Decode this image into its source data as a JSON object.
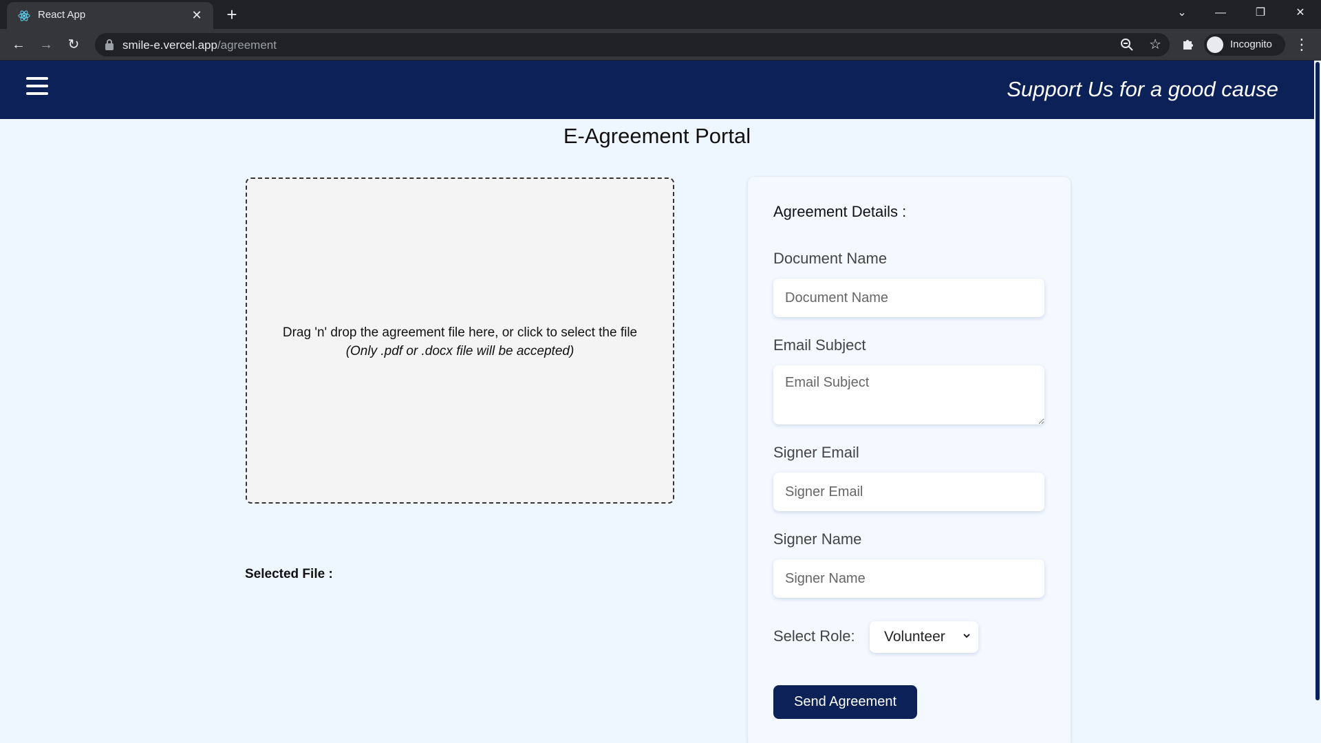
{
  "browser": {
    "tab_title": "React App",
    "tab_close": "✕",
    "new_tab": "+",
    "url_host": "smile-e.vercel.app",
    "url_path": "/agreement",
    "profile_label": "Incognito",
    "window_controls": {
      "tab_search": "⌄",
      "minimize": "—",
      "restore": "❐",
      "close": "✕"
    },
    "nav": {
      "back": "←",
      "forward": "→",
      "reload": "↻"
    },
    "menu": "⋮",
    "bookmark": "☆"
  },
  "header": {
    "tagline": "Support Us for a good cause"
  },
  "page": {
    "title": "E-Agreement Portal"
  },
  "dropzone": {
    "instruction": "Drag 'n' drop the agreement file here, or click to select the file",
    "hint": "(Only .pdf or .docx file will be accepted)"
  },
  "selected_file": {
    "label": "Selected File :"
  },
  "form": {
    "heading": "Agreement Details :",
    "document_name": {
      "label": "Document Name",
      "placeholder": "Document Name",
      "value": ""
    },
    "email_subject": {
      "label": "Email Subject",
      "placeholder": "Email Subject",
      "value": ""
    },
    "signer_email": {
      "label": "Signer Email",
      "placeholder": "Signer Email",
      "value": ""
    },
    "signer_name": {
      "label": "Signer Name",
      "placeholder": "Signer Name",
      "value": ""
    },
    "role": {
      "label": "Select Role:",
      "selected": "Volunteer"
    },
    "submit_label": "Send Agreement"
  },
  "colors": {
    "header_bg": "#0b2157",
    "page_bg": "#eef6ff",
    "button_bg": "#0b2157"
  },
  "icons": [
    "react-icon",
    "lock-icon",
    "zoom-icon",
    "star-icon",
    "puzzle-icon",
    "incognito-icon",
    "hamburger-icon",
    "chevron-down-icon"
  ]
}
